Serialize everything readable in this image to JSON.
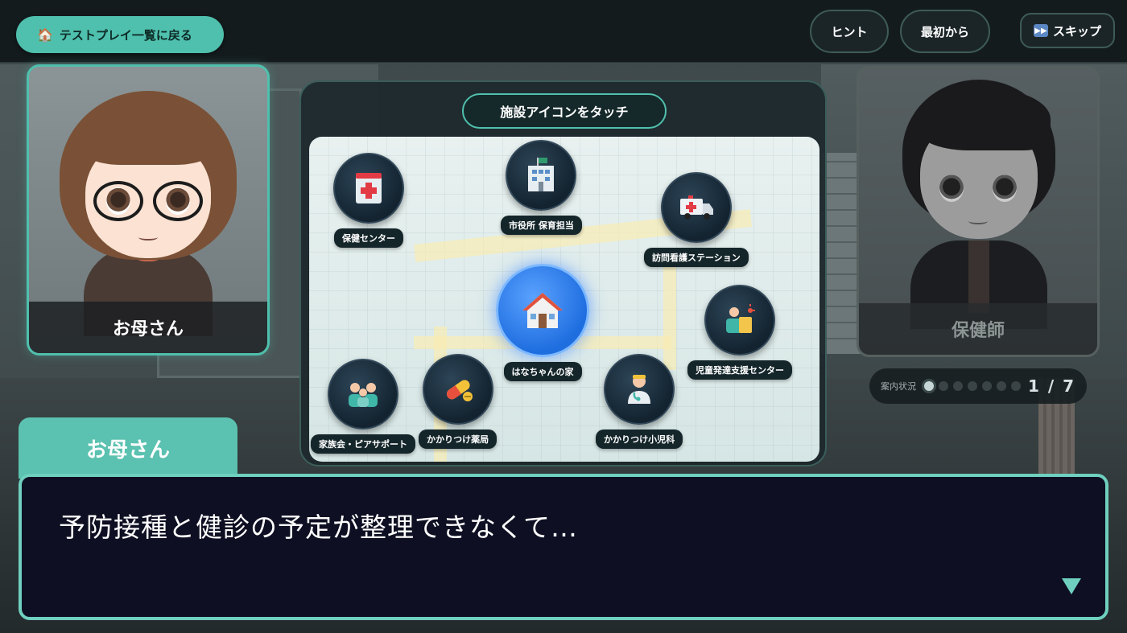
{
  "topbar": {
    "back_label": "テストプレイ一覧に戻る",
    "back_icon": "🏠",
    "hint_label": "ヒント",
    "restart_label": "最初から",
    "skip_label": "スキップ",
    "skip_icon": "⏭"
  },
  "characters": {
    "left_name": "お母さん",
    "right_name": "保健師"
  },
  "map": {
    "title": "施設アイコンをタッチ",
    "facilities": [
      {
        "label": "保健センター",
        "icon": "clinic-icon"
      },
      {
        "label": "市役所 保育担当",
        "icon": "city-hall-icon"
      },
      {
        "label": "訪問看護ステーション",
        "icon": "ambulance-icon"
      },
      {
        "label": "はなちゃんの家",
        "icon": "house-icon"
      },
      {
        "label": "児童発達支援センター",
        "icon": "support-icon"
      },
      {
        "label": "家族会・ピアサポート",
        "icon": "family-icon"
      },
      {
        "label": "かかりつけ薬局",
        "icon": "pill-icon"
      },
      {
        "label": "かかりつけ小児科",
        "icon": "doctor-icon"
      }
    ]
  },
  "progress": {
    "label": "案内状況",
    "current": 1,
    "total": 7,
    "text": "1 / 7"
  },
  "dialogue": {
    "speaker": "お母さん",
    "text": "予防接種と健診の予定が整理できなくて…"
  },
  "colors": {
    "accent": "#4fc0ad",
    "dialog_bg": "#0e0f22",
    "home": "#1f6ee0"
  }
}
